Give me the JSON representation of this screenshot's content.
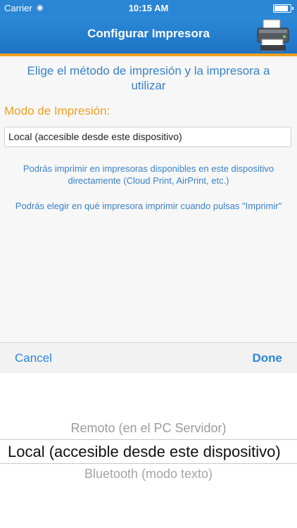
{
  "status": {
    "carrier": "Carrier",
    "time": "10:15 AM",
    "wifi_icon": "wifi-icon",
    "battery_level": 0.95
  },
  "nav": {
    "title": "Configurar Impresora",
    "icon": "printer-icon"
  },
  "content": {
    "subtitle": "Elige el método de impresión y la impresora a utilizar",
    "mode_label": "Modo de Impresión:",
    "mode_value": "Local (accesible desde este dispositivo)",
    "help1": "Podrás imprimir en impresoras disponibles en este dispositivo directamente (Cloud Print, AirPrint, etc.)",
    "help2": "Podrás elegir en qué impresora imprimir cuando pulsas \"Imprimir\""
  },
  "toolbar": {
    "cancel": "Cancel",
    "done": "Done"
  },
  "picker": {
    "options": [
      "Remoto (en el PC Servidor)",
      "Local (accesible desde este dispositivo)",
      "Bluetooth (modo texto)"
    ],
    "selected_index": 1
  },
  "colors": {
    "nav_blue": "#1f73c3",
    "accent_orange": "#f0a021",
    "text_blue": "#3a82c8"
  }
}
